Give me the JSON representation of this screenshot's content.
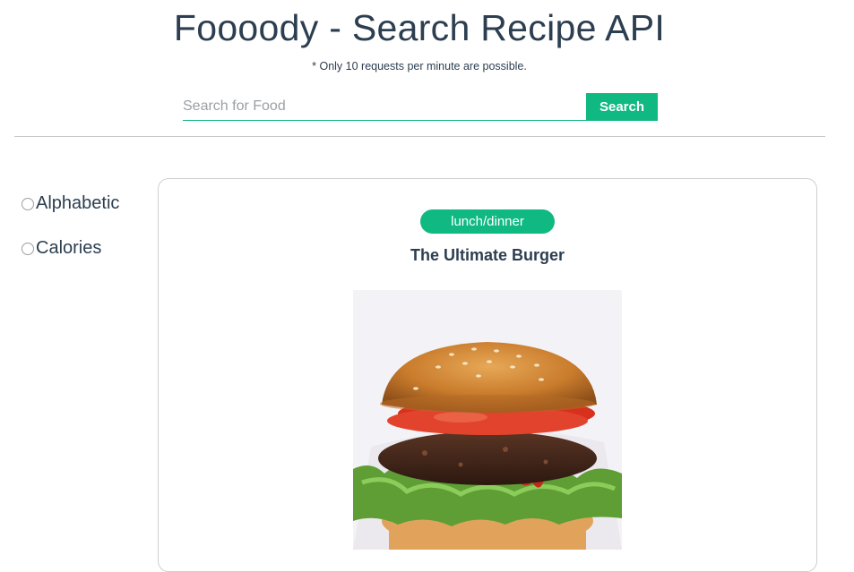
{
  "header": {
    "title": "Foooody - Search Recipe API",
    "subtitle": "* Only 10 requests per minute are possible."
  },
  "search": {
    "placeholder": "Search for Food",
    "value": "",
    "button_label": "Search"
  },
  "sort": {
    "options": [
      {
        "label": "Alphabetic",
        "selected": false
      },
      {
        "label": "Calories",
        "selected": false
      }
    ]
  },
  "recipes": [
    {
      "tag": "lunch/dinner",
      "title": "The Ultimate Burger",
      "image": "burger-photo"
    }
  ],
  "colors": {
    "accent": "#10b981",
    "text": "#2c3e50",
    "divider": "#c8c8c8"
  }
}
